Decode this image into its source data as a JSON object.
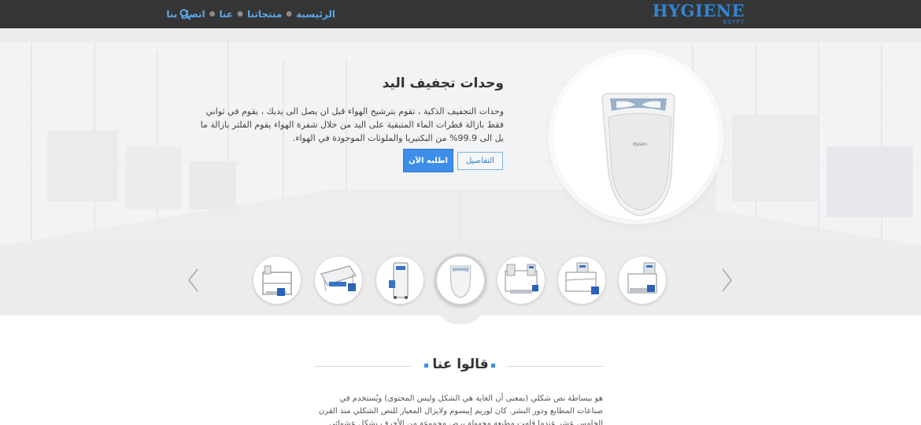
{
  "header": {
    "logo_text": "HYGIENE",
    "logo_subtext": "EGYPT",
    "nav": [
      {
        "label": "الرئيسية"
      },
      {
        "label": "منتجاتنا"
      },
      {
        "label": "عنا"
      },
      {
        "label": "اتصل بنا"
      }
    ],
    "search_icon": "search-icon"
  },
  "hero": {
    "title": "وحدات تجفيف اليد",
    "description": "وحدات التجفيف الذكية ، تقوم بترشيح الهواء قبل ان يصل الى يديك ، يقوم في ثواني فقط بازالة قطرات الماء المتبقية على اليد من خلال شفرة الهواء  يقوم الفلتر بازالة ما يل الى 99.9% من البكتيريا والملوثات الموجودة في الهواء.",
    "details_button": "التفاصيل",
    "order_button": "اطلبه الآن",
    "product_badge": "dyson"
  },
  "carousel": {
    "prev_icon": "chevron-left-icon",
    "next_icon": "chevron-right-icon",
    "active_index": 3,
    "items": [
      {
        "product": "hygiene-station-sole-cleaner"
      },
      {
        "product": "sole-cleaning-machine"
      },
      {
        "product": "hand-disinfection-tower"
      },
      {
        "product": "hand-dryer"
      },
      {
        "product": "hygiene-station-with-sinks"
      },
      {
        "product": "hygiene-station-turnstile"
      },
      {
        "product": "hygiene-station-compact"
      }
    ]
  },
  "testimonials": {
    "title": "قالوا عنا",
    "text": "هو ببساطة نص شكلي (بمعنى أن الغاية هي الشكل وليس المحتوى) ويُستخدم في صناعات المطابع ودور النشر. كان لوريم إيبسوم ولايزال المعيار للنص الشكلي منذ القرن الخامس عشر عندما قامت مطبعة مجهولة برص مجموعة من الأحرف بشكل عشوائي أخذتها من نص، لتكوّن كتيّب بمثابة"
  },
  "colors": {
    "accent": "#3c8ee8",
    "topbar": "#353535",
    "logo": "#2f86d6"
  }
}
